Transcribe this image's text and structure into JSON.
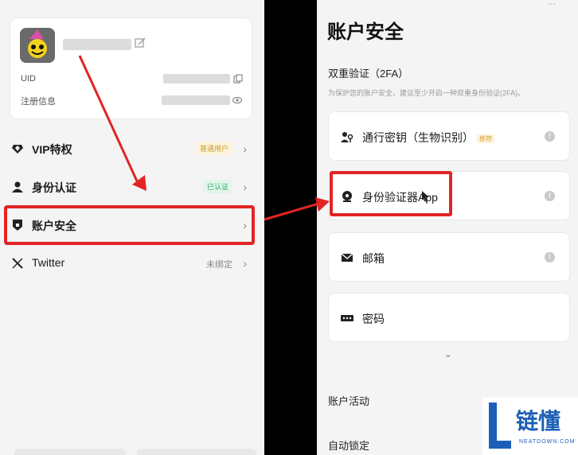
{
  "left_panel": {
    "profile": {
      "uid_label": "UID",
      "reg_label": "注册信息"
    },
    "menu": [
      {
        "label": "VIP特权",
        "badge": "普通用户",
        "icon": "diamond-icon"
      },
      {
        "label": "身份认证",
        "badge": "已认证",
        "icon": "person-icon"
      },
      {
        "label": "账户安全",
        "icon": "shield-icon"
      },
      {
        "label": "Twitter",
        "right_text": "未绑定",
        "icon": "x-logo-icon"
      }
    ]
  },
  "right_panel": {
    "title": "账户安全",
    "section_title": "双重验证（2FA）",
    "description": "为保护您的账户安全，建议至少开启一种双重身份验证(2FA)。",
    "options": [
      {
        "label": "通行密钥（生物识别）",
        "badge": "推荐",
        "icon": "passkey-icon"
      },
      {
        "label": "身份验证器App",
        "icon": "authenticator-icon"
      },
      {
        "label": "邮箱",
        "icon": "mail-icon"
      },
      {
        "label": "密码",
        "icon": "password-icon"
      }
    ],
    "account_activity": "账户活动",
    "auto_lock": "自动锁定"
  },
  "watermark": {
    "title": "链懂",
    "subtitle": "NEATDOWN.COM"
  },
  "colors": {
    "highlight": "#e22424",
    "brand": "#1d5fb6"
  }
}
